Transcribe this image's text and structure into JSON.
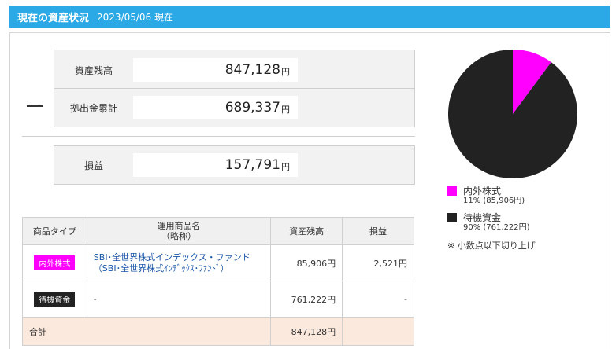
{
  "header": {
    "title": "現在の資産状況",
    "date": "2023/05/06 現在"
  },
  "summary": {
    "balance_label": "資産残高",
    "balance_value": "847,128",
    "contrib_label": "拠出金累計",
    "contrib_value": "689,337",
    "profit_label": "損益",
    "profit_value": "157,791",
    "yen": "円",
    "toggle_symbol": "—"
  },
  "table": {
    "headers": {
      "type": "商品タイプ",
      "name1": "運用商品名",
      "name2": "（略称）",
      "balance": "資産残高",
      "profit": "損益"
    },
    "rows": [
      {
        "type": "内外株式",
        "name1": "SBI･全世界株式インデックス・ファンド",
        "name2": "（SBI･全世界株式ｲﾝﾃﾞｯｸｽ･ﾌｧﾝﾄﾞ）",
        "balance": "85,906円",
        "profit": "2,521円"
      },
      {
        "type": "待機資金",
        "name1": "-",
        "name2": "",
        "balance": "761,222円",
        "profit": "-"
      }
    ],
    "total": {
      "label": "合計",
      "balance": "847,128円",
      "profit": ""
    }
  },
  "colors": {
    "header": "#2aa9e6",
    "stock": "#ff00ff",
    "cash": "#222222"
  },
  "chart_data": {
    "type": "pie",
    "title": "",
    "slices": [
      {
        "name": "内外株式",
        "percent": 11,
        "value": 85906,
        "label": "11% (85,906円)",
        "color": "#ff00ff"
      },
      {
        "name": "待機資金",
        "percent": 90,
        "value": 761222,
        "label": "90% (761,222円)",
        "color": "#222222"
      }
    ],
    "note": "※ 小数点以下切り上げ"
  }
}
